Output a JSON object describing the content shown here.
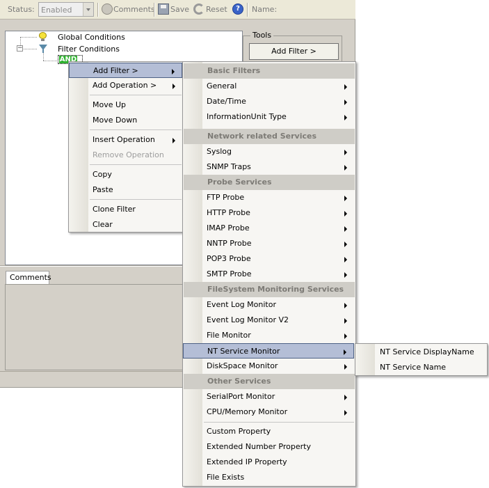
{
  "toolbar": {
    "status_label": "Status:",
    "status_value": "Enabled",
    "comments_label": "Comments",
    "save_label": "Save",
    "reset_label": "Reset",
    "help_glyph": "?",
    "name_label": "Name:"
  },
  "tree": {
    "global_conditions": "Global Conditions",
    "filter_conditions": "Filter Conditions",
    "and_node": "AND",
    "expander_glyph": "−"
  },
  "tools": {
    "group_label": "Tools",
    "add_filter_label": "Add Filter >"
  },
  "comments_tab": "Comments",
  "context_menu": {
    "add_filter": "Add Filter >",
    "add_operation": "Add Operation >",
    "move_up": "Move Up",
    "move_down": "Move Down",
    "insert_operation": "Insert Operation",
    "remove_operation": "Remove Operation",
    "copy": "Copy",
    "paste": "Paste",
    "clone_filter": "Clone Filter",
    "clear": "Clear"
  },
  "filter_menu": {
    "basic_filters": "Basic Filters",
    "general": "General",
    "date_time": "Date/Time",
    "information_unit_type": "InformationUnit Type",
    "network_services": "Network related Services",
    "syslog": "Syslog",
    "snmp_traps": "SNMP Traps",
    "probe_services": "Probe Services",
    "ftp_probe": "FTP Probe",
    "http_probe": "HTTP Probe",
    "imap_probe": "IMAP Probe",
    "nntp_probe": "NNTP Probe",
    "pop3_probe": "POP3 Probe",
    "smtp_probe": "SMTP Probe",
    "filesystem_services": "FileSystem Monitoring Services",
    "event_log_monitor": "Event Log Monitor",
    "event_log_monitor_v2": "Event Log Monitor V2",
    "file_monitor": "File Monitor",
    "nt_service_monitor": "NT Service Monitor",
    "diskspace_monitor": "DiskSpace Monitor",
    "other_services": "Other Services",
    "serialport_monitor": "SerialPort Monitor",
    "cpu_memory_monitor": "CPU/Memory Monitor",
    "custom_property": "Custom Property",
    "extended_number_property": "Extended Number Property",
    "extended_ip_property": "Extended IP Property",
    "file_exists": "File Exists"
  },
  "nt_service_menu": {
    "display_name": "NT Service DisplayName",
    "service_name": "NT Service Name"
  },
  "colors": {
    "highlight_bg": "#b4bed6",
    "highlight_border": "#4d6185",
    "and_node_green": "#2fb22f",
    "window_bg": "#d4d0c8"
  }
}
